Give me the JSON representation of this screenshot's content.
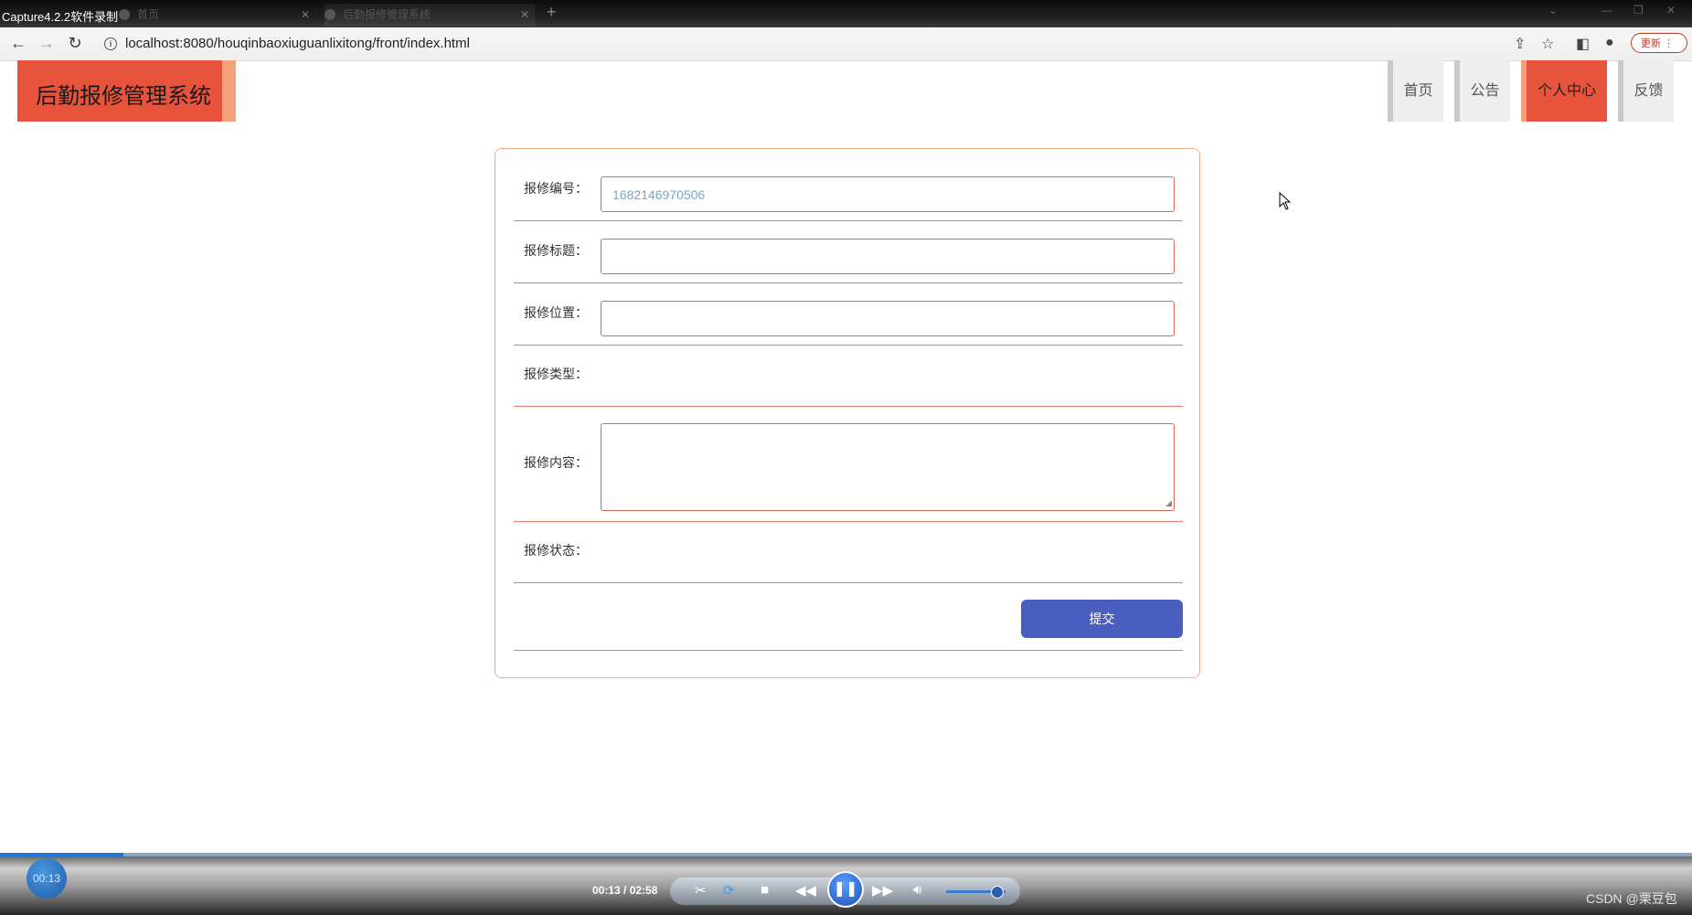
{
  "titlebar": {
    "app_title": "Capture4.2.2软件录制",
    "tab1": "首页",
    "tab2": "后勤报修管理系统"
  },
  "browser": {
    "url": "localhost:8080/houqinbaoxiuguanlixitong/front/index.html",
    "update_label": "更新"
  },
  "site": {
    "logo_text": "后勤报修管理系统",
    "nav": [
      {
        "label": "首页"
      },
      {
        "label": "公告"
      },
      {
        "label": "个人中心"
      },
      {
        "label": "反馈"
      }
    ],
    "colors": {
      "accent": "#e8533c",
      "stripe": "#f4a27d",
      "button": "#4a5ec0"
    }
  },
  "form": {
    "fields": [
      {
        "label": "报修编号：",
        "value": "1682146970506"
      },
      {
        "label": "报修标题：",
        "value": ""
      },
      {
        "label": "报修位置：",
        "value": ""
      },
      {
        "label": "报修类型：",
        "value": ""
      },
      {
        "label": "报修内容：",
        "value": ""
      },
      {
        "label": "报修状态：",
        "value": ""
      }
    ],
    "submit_label": "提交"
  },
  "player": {
    "current_time": "00:13",
    "time_display": "00:13 / 02:58",
    "progress": 0.073,
    "volume": 0.85
  },
  "watermark": "CSDN @栗豆包"
}
